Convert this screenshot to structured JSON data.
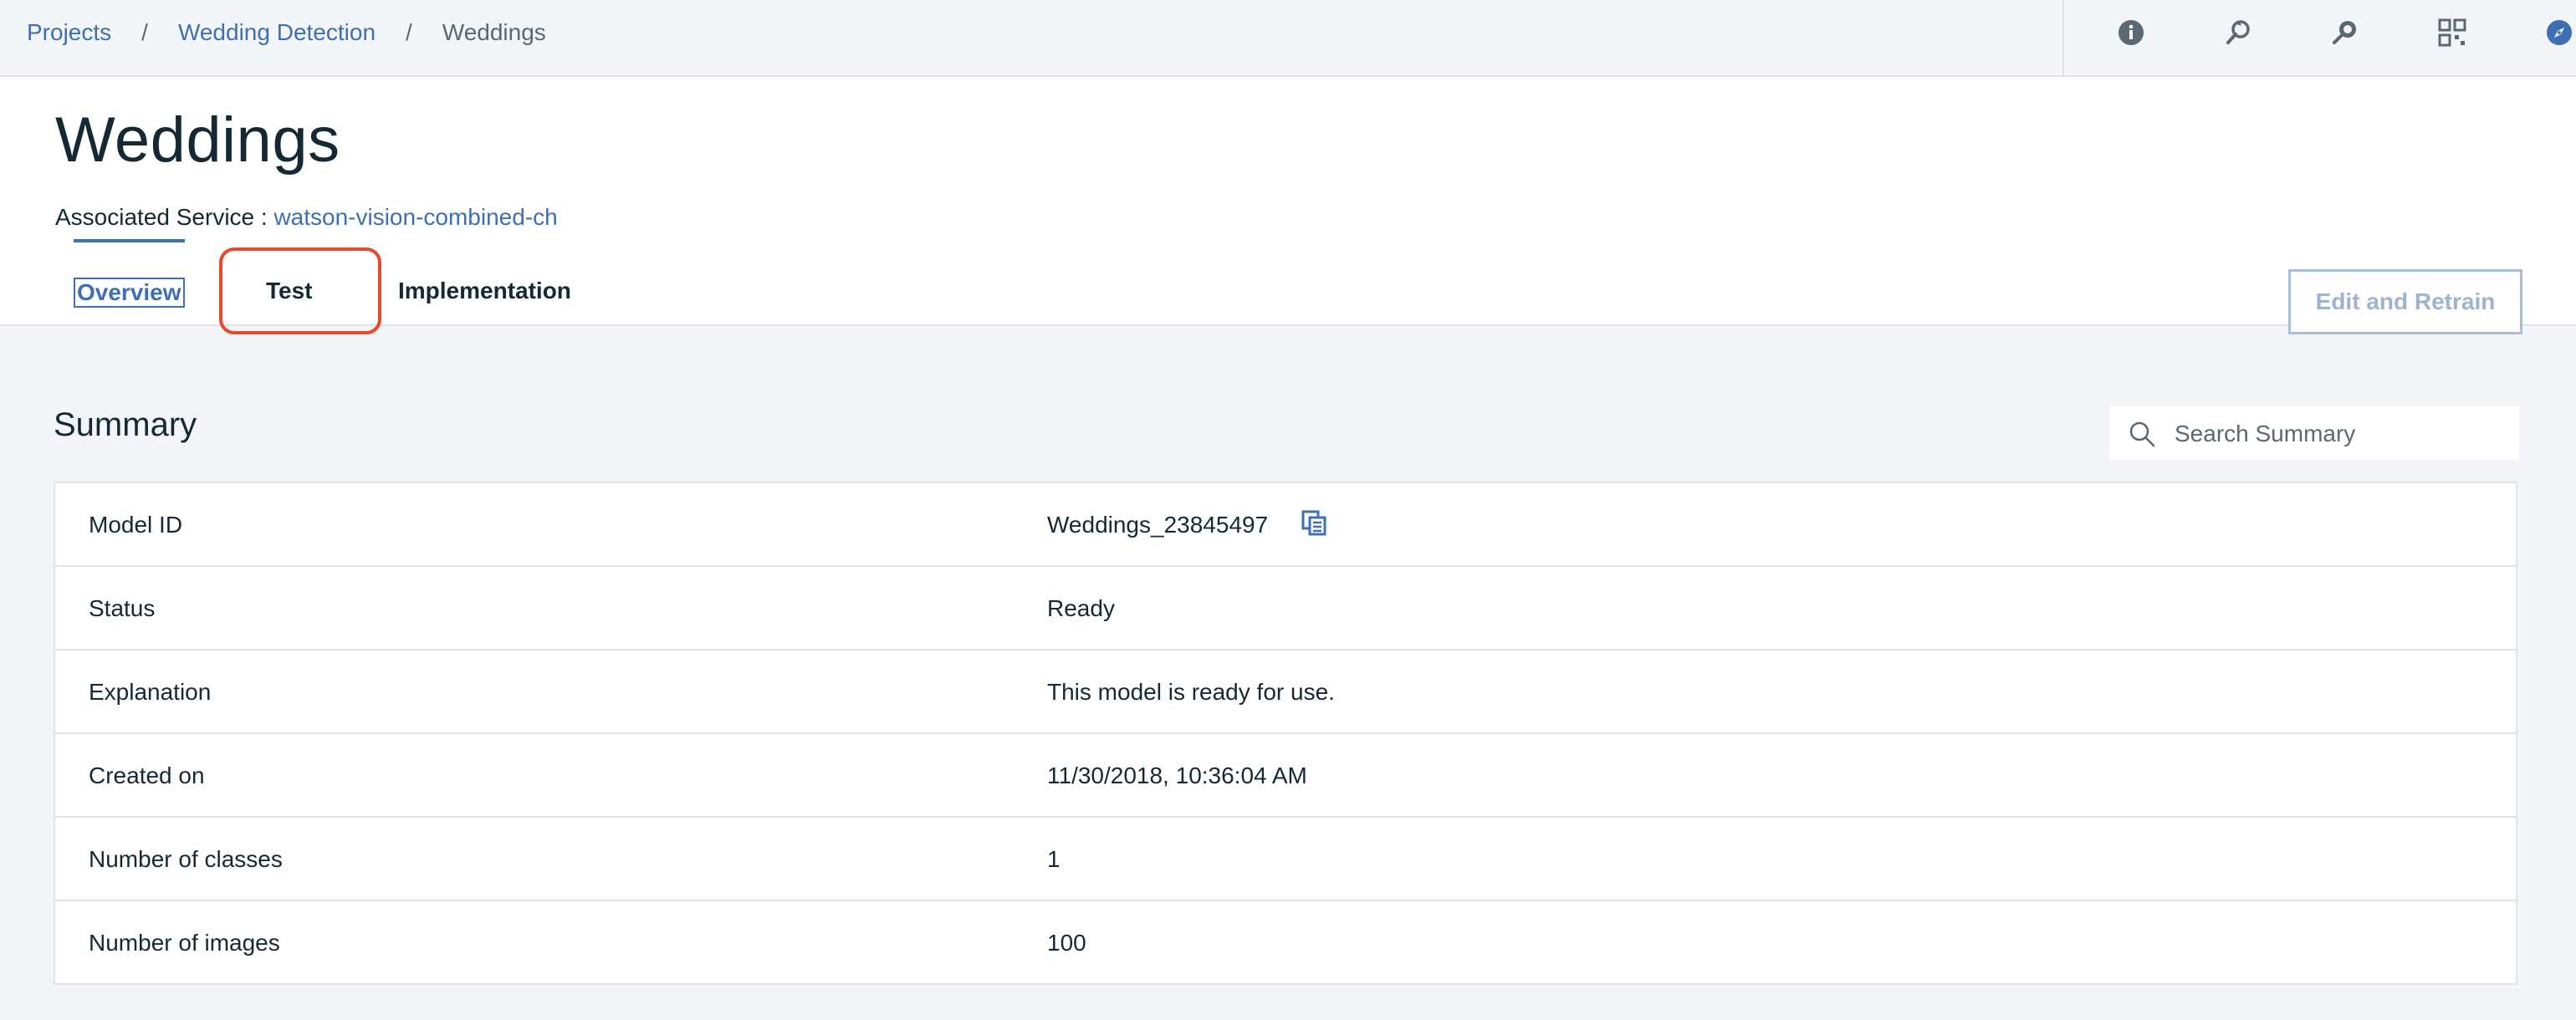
{
  "breadcrumb": {
    "projects": "Projects",
    "wedding_detection": "Wedding Detection",
    "current": "Weddings",
    "separator": "/"
  },
  "toolbar_icons": [
    "info-icon",
    "refresh-search-icon",
    "search-tag-icon",
    "grid-scan-icon",
    "compass-icon"
  ],
  "page": {
    "title": "Weddings",
    "associated_label": "Associated Service :",
    "associated_service": "watson-vision-combined-ch",
    "edit_button": "Edit and Retrain"
  },
  "tabs": [
    {
      "label": "Overview",
      "active": true
    },
    {
      "label": "Test",
      "active": false
    },
    {
      "label": "Implementation",
      "active": false
    }
  ],
  "summary": {
    "title": "Summary",
    "search_placeholder": "Search Summary",
    "rows": [
      {
        "label": "Model ID",
        "value": "Weddings_23845497"
      },
      {
        "label": "Status",
        "value": "Ready"
      },
      {
        "label": "Explanation",
        "value": "This model is ready for use."
      },
      {
        "label": "Created on",
        "value": "11/30/2018, 10:36:04 AM"
      },
      {
        "label": "Number of classes",
        "value": "1"
      },
      {
        "label": "Number of images",
        "value": "100"
      }
    ]
  },
  "colors": {
    "link": "#3d70b2",
    "highlight": "#e8492e",
    "text": "#152935",
    "background": "#f3f5f9"
  }
}
